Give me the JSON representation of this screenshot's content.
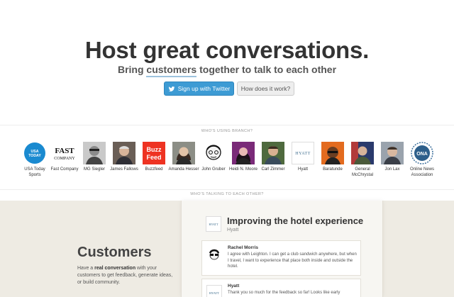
{
  "hero": {
    "title": "Host great conversations.",
    "subtitle_pre": "Bring ",
    "subtitle_link": "customers",
    "subtitle_post": " together to talk to each other",
    "signup_label": "Sign up with Twitter",
    "how_label": "How does it work?"
  },
  "sections": {
    "users_label": "WHO'S USING BRANCH?",
    "talking_label": "WHO'S TALKING TO EACH OTHER?"
  },
  "users": [
    {
      "name": "USA Today Sports"
    },
    {
      "name": "Fast Company"
    },
    {
      "name": "MG Siegler"
    },
    {
      "name": "James Fallows"
    },
    {
      "name": "Buzzfeed"
    },
    {
      "name": "Amanda Hesser"
    },
    {
      "name": "John Gruber"
    },
    {
      "name": "Heidi N. Moore"
    },
    {
      "name": "Carl Zimmer"
    },
    {
      "name": "Hyatt"
    },
    {
      "name": "Baratunde"
    },
    {
      "name": "General McChrystal"
    },
    {
      "name": "Jon Lax"
    },
    {
      "name": "Online News Association"
    }
  ],
  "customers": {
    "title": "Customers",
    "desc_pre": "Have a ",
    "desc_bold": "real conversation",
    "desc_post": " with your customers to get feedback, generate ideas, or build community."
  },
  "card": {
    "title": "Improving the hotel experience",
    "org": "Hyatt",
    "logo_text": "HYATT",
    "messages": [
      {
        "author": "Rachel Morris",
        "text": "I agree with Leighton. I can get a club sandwich anywhere, but when I travel, I want to experience that place both inside and outside the hotel."
      },
      {
        "author": "Hyatt",
        "text": "Thank you so much for the feedback so far! Looks like early"
      }
    ]
  },
  "logos": {
    "usa_today": "USA TODAY",
    "fast_company": "FAST COMPANY",
    "buzzfeed": "Buzz Feed",
    "hyatt": "HYATT",
    "ona": "ONA"
  },
  "colors": {
    "twitter_blue": "#3d9bd4",
    "lower_bg": "#eeebe3",
    "buzzfeed_red": "#ee3322",
    "usa_blue": "#1a8ad0"
  }
}
